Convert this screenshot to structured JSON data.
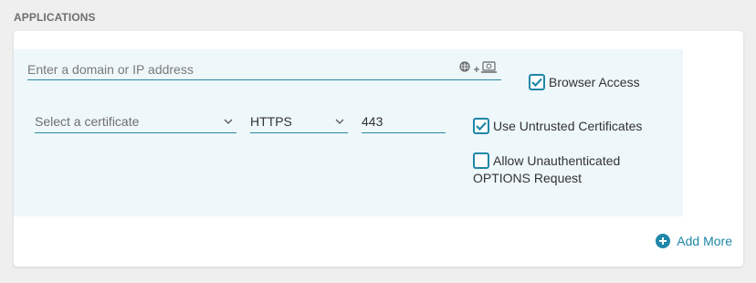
{
  "section": {
    "title": "APPLICATIONS"
  },
  "application": {
    "domain_placeholder": "Enter a domain or IP address",
    "browser_access": {
      "label": "Browser Access",
      "checked": true
    },
    "certificate": {
      "placeholder": "Select a certificate"
    },
    "protocol": {
      "value": "HTTPS"
    },
    "port": {
      "value": "443"
    },
    "untrusted_certs": {
      "label": "Use Untrusted Certificates",
      "checked": true
    },
    "allow_options": {
      "label": "Allow Unauthenticated OPTIONS Request",
      "checked": false
    }
  },
  "actions": {
    "add_more_label": "Add More"
  },
  "colors": {
    "accent": "#1f87a8",
    "row_bg": "#eef7fa",
    "underline": "#2a8aa0"
  },
  "icons": [
    "globe-icon",
    "plus-icon",
    "monitor-icon",
    "chevron-down-icon",
    "checkmark-icon",
    "add-circle-icon"
  ]
}
